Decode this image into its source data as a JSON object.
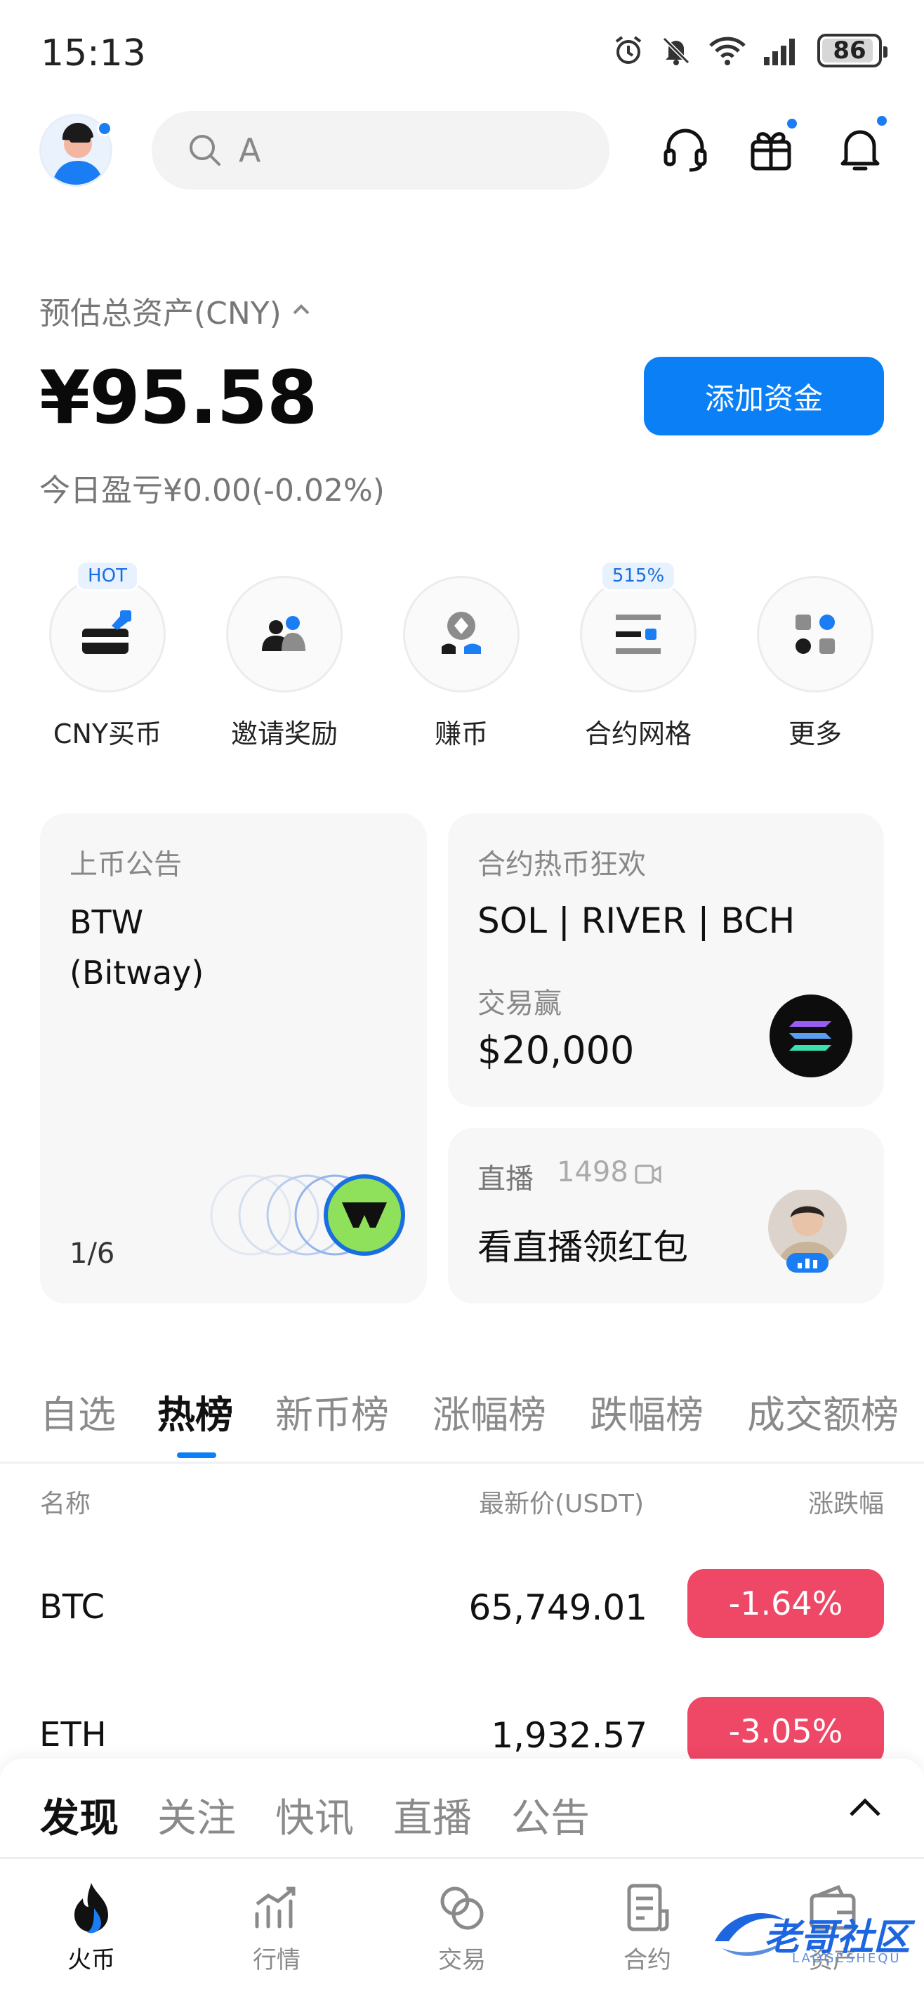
{
  "status_bar": {
    "time": "15:13",
    "battery": "86"
  },
  "header": {
    "search_placeholder": "A"
  },
  "assets": {
    "label": "预估总资产(CNY)",
    "value": "¥95.58",
    "pnl": "今日盈亏¥0.00(-0.02%)",
    "add_funds": "添加资金"
  },
  "shortcuts": [
    {
      "label": "CNY买币",
      "badge": "HOT",
      "icon": "buy-card-icon"
    },
    {
      "label": "邀请奖励",
      "badge": "",
      "icon": "invite-users-icon"
    },
    {
      "label": "赚币",
      "badge": "",
      "icon": "earn-icon"
    },
    {
      "label": "合约网格",
      "badge": "515%",
      "icon": "grid-icon"
    },
    {
      "label": "更多",
      "badge": "",
      "icon": "more-apps-icon"
    }
  ],
  "cards": {
    "listing": {
      "label": "上币公告",
      "title_line1": "BTW",
      "title_line2": "(Bitway)",
      "pager": "1/6"
    },
    "futures": {
      "label": "合约热币狂欢",
      "title": "SOL | RIVER | BCH",
      "sub": "交易赢",
      "prize": "$20,000"
    },
    "live": {
      "label": "直播",
      "viewers": "1498",
      "title": "看直播领红包"
    }
  },
  "tabs": [
    "自选",
    "热榜",
    "新币榜",
    "涨幅榜",
    "跌幅榜",
    "成交额榜"
  ],
  "list_header": {
    "name": "名称",
    "price": "最新价(USDT)",
    "change": "涨跌幅"
  },
  "rows": [
    {
      "name": "BTC",
      "price": "65,749.01",
      "change": "-1.64%"
    },
    {
      "name": "ETH",
      "price": "1,932.57",
      "change": "-3.05%"
    }
  ],
  "sheet_tabs": [
    "发现",
    "关注",
    "快讯",
    "直播",
    "公告"
  ],
  "bottom_nav": [
    "火币",
    "行情",
    "交易",
    "合约",
    "资产"
  ],
  "watermark": {
    "text": "老哥社区",
    "sub": "LAOGESHEQU"
  },
  "colors": {
    "accent": "#0b7ff5",
    "down": "#ef4766"
  }
}
